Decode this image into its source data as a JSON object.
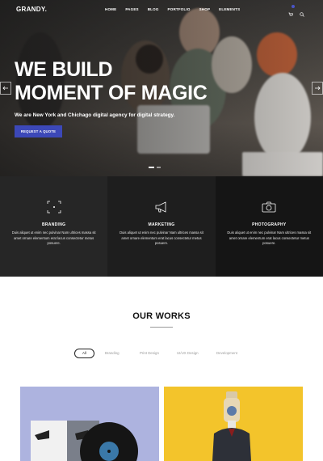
{
  "header": {
    "logo": "GRANDY.",
    "nav": [
      "HOME",
      "PAGES",
      "BLOG",
      "PORTFOLIO",
      "SHOP",
      "ELEMENTS"
    ],
    "icons": [
      "cart-icon",
      "search-icon"
    ],
    "accent_color": "#3c48b8"
  },
  "hero": {
    "title_line1": "WE BUILD",
    "title_line2": "MOMENT OF MAGIC",
    "subtitle": "We are New York and Chichago digital agency for digital strategy.",
    "cta_label": "REQUEST A QUOTE",
    "icons": [
      "arrow-left-icon",
      "arrow-right-icon"
    ]
  },
  "services": [
    {
      "icon": "focus-icon",
      "title": "BRANDING",
      "text": "Duis aliquet ut enim nec pulvinar Nam ultrices massa sit amet ornare elementum erat lacus consectetur metus posuere."
    },
    {
      "icon": "megaphone-icon",
      "title": "MARKETING",
      "text": "Duis aliquet ut enim nec pulvinar Nam ultrices massa sit amet ornare elementum erat lacus consectetur metus posuere."
    },
    {
      "icon": "camera-icon",
      "title": "PHOTOGRAPHY",
      "text": "Duis aliquet ut enim nec pulvinar Nam ultrices massa sit amet ornare elementum erat lacus consectetur metus posuere."
    }
  ],
  "works": {
    "title": "OUR WORKS",
    "filters": [
      "All",
      "Branding",
      "Print Design",
      "UI/UX Design",
      "Development"
    ],
    "active_filter": "All",
    "card_colors": [
      "#adb3df",
      "#f3c42b"
    ]
  }
}
